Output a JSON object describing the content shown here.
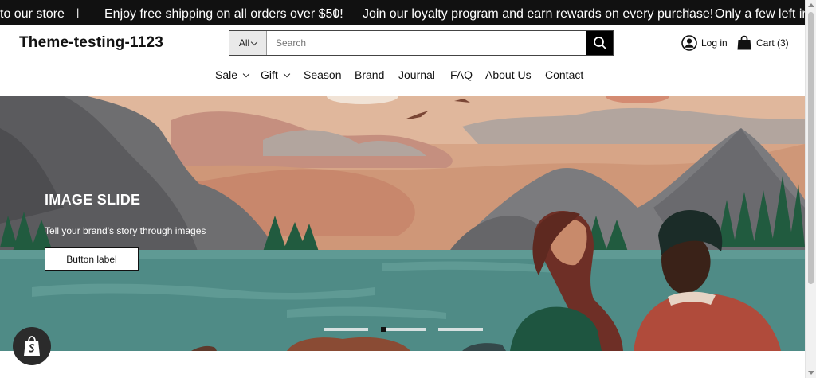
{
  "announcement": {
    "messages": [
      "to our store",
      "Enjoy free shipping on all orders over $50!",
      "Join our loyalty program and earn rewards on every purchase!",
      "Only a few left in s"
    ],
    "separator": "|"
  },
  "header": {
    "store_name": "Theme-testing-1123",
    "search": {
      "category": "All",
      "placeholder": "Search"
    },
    "login_label": "Log in",
    "cart_label": "Cart (3)"
  },
  "nav": {
    "items": [
      {
        "label": "Sale",
        "has_dropdown": true
      },
      {
        "label": "Gift",
        "has_dropdown": true
      },
      {
        "label": "Season",
        "has_dropdown": false
      },
      {
        "label": "Brand",
        "has_dropdown": false
      },
      {
        "label": "Journal",
        "has_dropdown": false
      },
      {
        "label": "FAQ",
        "has_dropdown": false
      },
      {
        "label": "About Us",
        "has_dropdown": false
      },
      {
        "label": "Contact",
        "has_dropdown": false
      }
    ]
  },
  "hero": {
    "title": "IMAGE SLIDE",
    "subtitle": "Tell your brand's story through images",
    "button_label": "Button label",
    "slide_count": 3,
    "active_slide": 2
  },
  "colors": {
    "announcement_bg": "#111111",
    "accent": "#000000",
    "sky": "#d7a587",
    "water": "#4f8b86"
  },
  "icons": [
    "search-icon",
    "user-icon",
    "shopping-bag-icon",
    "chevron-down-icon",
    "shopify-bag-icon"
  ]
}
